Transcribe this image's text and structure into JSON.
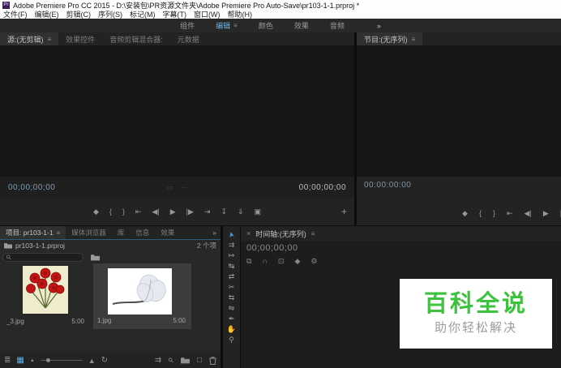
{
  "title_bar": {
    "title": "Adobe Premiere Pro CC 2015 - D:\\安装包\\PR资源文件夹\\Adobe Premiere Pro Auto-Save\\pr103-1-1.prproj *",
    "app_icon_text": "Pr"
  },
  "menu_bar": {
    "items": [
      "文件(F)",
      "编辑(E)",
      "剪辑(C)",
      "序列(S)",
      "标记(M)",
      "字幕(T)",
      "窗口(W)",
      "帮助(H)"
    ]
  },
  "workspace_bar": {
    "tabs": [
      {
        "label": "组件",
        "active": false
      },
      {
        "label": "编辑",
        "active": true
      },
      {
        "label": "颜色",
        "active": false
      },
      {
        "label": "效果",
        "active": false
      },
      {
        "label": "音频",
        "active": false
      }
    ],
    "active_menu_icon": "≡",
    "overflow_icon": "»"
  },
  "source_monitor": {
    "tabs": [
      {
        "label": "源:(无剪辑)",
        "active": true
      },
      {
        "label": "效果控件",
        "active": false
      },
      {
        "label": "音频剪辑混合器:",
        "active": false
      },
      {
        "label": "元数据",
        "active": false
      }
    ],
    "menu_icon": "≡",
    "timecode_current": "00;00;00;00",
    "timecode_duration": "00;00;00;00",
    "zoom_select_glyph": "▭",
    "resolution_select_glyph": "⋯",
    "transport": [
      {
        "name": "add-marker-button",
        "glyph": "◆"
      },
      {
        "name": "mark-in-button",
        "glyph": "{"
      },
      {
        "name": "mark-out-button",
        "glyph": "}"
      },
      {
        "name": "go-to-in-button",
        "glyph": "⇤"
      },
      {
        "name": "step-back-button",
        "glyph": "◀|"
      },
      {
        "name": "play-button",
        "glyph": "▶"
      },
      {
        "name": "step-forward-button",
        "glyph": "|▶"
      },
      {
        "name": "go-to-out-button",
        "glyph": "⇥"
      },
      {
        "name": "insert-button",
        "glyph": "↧"
      },
      {
        "name": "overwrite-button",
        "glyph": "⇓"
      },
      {
        "name": "export-frame-button",
        "glyph": "▣"
      }
    ],
    "add_button_glyph": "+"
  },
  "program_monitor": {
    "tab_label": "节目:(无序列)",
    "menu_icon": "≡",
    "timecode_current": "00:00:00:00",
    "transport": [
      {
        "name": "add-marker-button",
        "glyph": "◆"
      },
      {
        "name": "mark-in-button",
        "glyph": "{"
      },
      {
        "name": "mark-out-button",
        "glyph": "}"
      },
      {
        "name": "go-to-in-button",
        "glyph": "⇤"
      },
      {
        "name": "step-back-button",
        "glyph": "◀|"
      },
      {
        "name": "play-button",
        "glyph": "▶"
      },
      {
        "name": "step-forward-button",
        "glyph": "|▶"
      }
    ]
  },
  "project_panel": {
    "tabs": [
      {
        "label": "项目: pr103-1-1",
        "active": true
      },
      {
        "label": "媒体浏览器",
        "active": false
      },
      {
        "label": "库",
        "active": false
      },
      {
        "label": "信息",
        "active": false
      },
      {
        "label": "效果",
        "active": false
      }
    ],
    "menu_icon": "≡",
    "overflow_icon": "»",
    "project_file": "pr103-1-1.prproj",
    "item_count": "2 个项",
    "clips": [
      {
        "name": "_3.jpg",
        "duration": "5:00",
        "selected": false
      },
      {
        "name": "1.jpg",
        "duration": "5:00",
        "selected": true
      }
    ],
    "toolbar": {
      "list_view_glyph": "≣",
      "icon_view_glyph": "▦",
      "zoom_out_glyph": "▲",
      "zoom_in_glyph": "▲",
      "sort_glyph": "↻",
      "automate_glyph": "⇉",
      "find_glyph": "⚲",
      "new_item_glyph": "□"
    }
  },
  "tools_panel": {
    "tools": [
      {
        "name": "selection-tool",
        "glyph": "➤",
        "active": true
      },
      {
        "name": "track-select-forward-tool",
        "glyph": "⇉"
      },
      {
        "name": "ripple-edit-tool",
        "glyph": "↦"
      },
      {
        "name": "rolling-edit-tool",
        "glyph": "↹"
      },
      {
        "name": "rate-stretch-tool",
        "glyph": "⇄"
      },
      {
        "name": "razor-tool",
        "glyph": "✂"
      },
      {
        "name": "slip-tool",
        "glyph": "⇆"
      },
      {
        "name": "slide-tool",
        "glyph": "⇋"
      },
      {
        "name": "pen-tool",
        "glyph": "✒"
      },
      {
        "name": "hand-tool",
        "glyph": "✋"
      },
      {
        "name": "zoom-tool",
        "glyph": "⚲"
      }
    ]
  },
  "timeline_panel": {
    "close_icon": "×",
    "tab_label": "时间轴:(无序列)",
    "menu_icon": "≡",
    "timecode": "00;00;00;00",
    "controls": [
      {
        "name": "insert-overwrite-sequence-button",
        "glyph": "⧉"
      },
      {
        "name": "snap-button",
        "glyph": "∩"
      },
      {
        "name": "linked-selection-button",
        "glyph": "⊡"
      },
      {
        "name": "add-marker-button",
        "glyph": "◆"
      },
      {
        "name": "timeline-settings-button",
        "glyph": "⚙"
      }
    ]
  },
  "watermark": {
    "title": "百科全说",
    "subtitle": "助你轻松解决",
    "title_color": "#3cc23c"
  },
  "colors": {
    "panel_bg": "#232323",
    "monitor_bg": "#161616",
    "accent_blue": "#46a0e0",
    "timecode_blue": "#7e9cb2",
    "titlebar_bg": "#fdfdfd",
    "watermark_green": "#3cc23c"
  }
}
